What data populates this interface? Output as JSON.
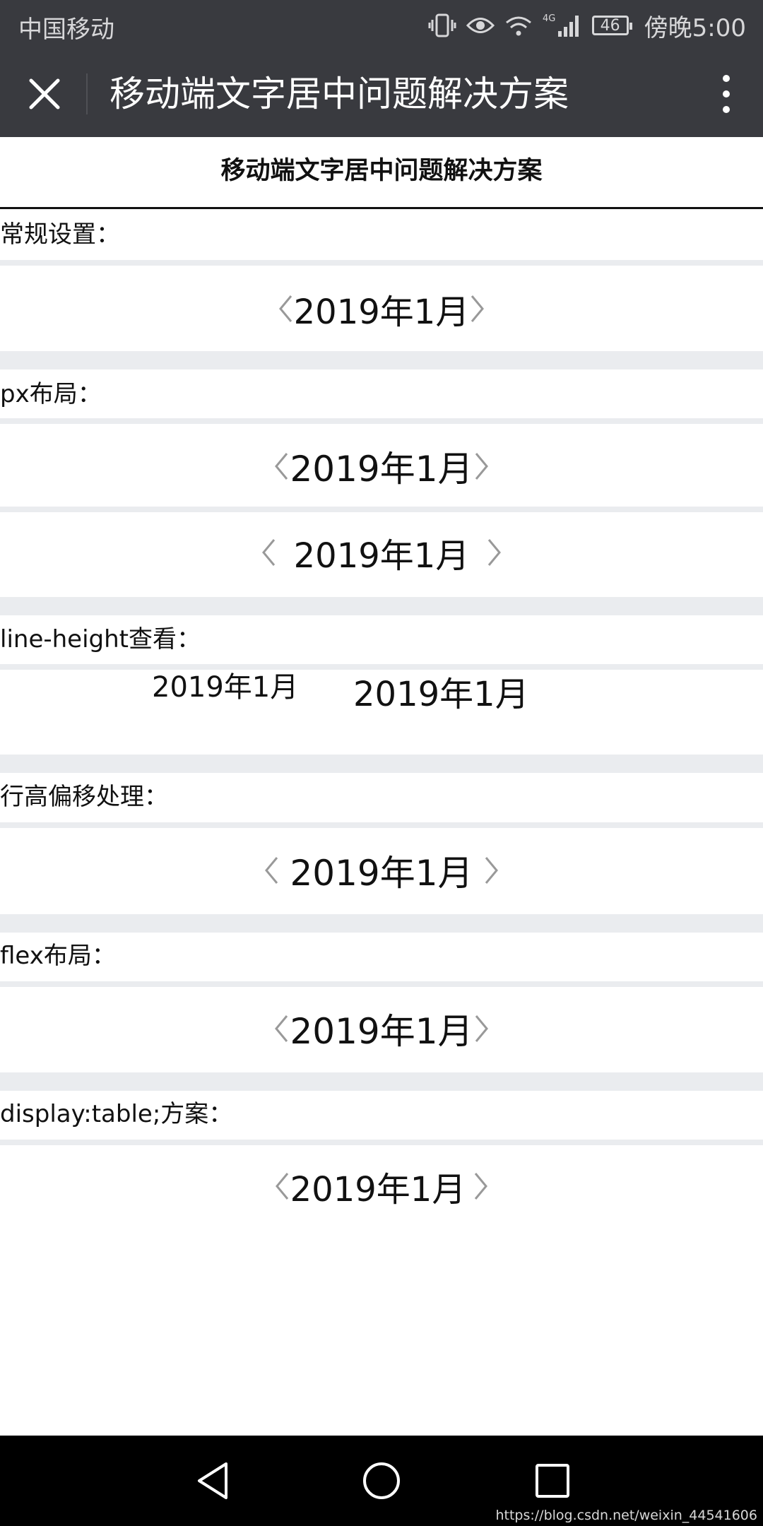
{
  "status_bar": {
    "carrier": "中国移动",
    "battery": "46",
    "network": "4G",
    "time": "傍晚5:00"
  },
  "title_bar": {
    "title": "移动端文字居中问题解决方案",
    "close_icon": "close-icon",
    "more_icon": "more-vertical-icon"
  },
  "page": {
    "heading": "移动端文字居中问题解决方案",
    "date_text": "2019年1月",
    "sections": [
      {
        "label": "常规设置："
      },
      {
        "label": "px布局："
      },
      {
        "label": "line-height查看："
      },
      {
        "label": "行高偏移处理："
      },
      {
        "label": "flex布局："
      },
      {
        "label": "display:table;方案："
      }
    ]
  },
  "nav_bar": {
    "back_icon": "triangle-back-icon",
    "home_icon": "circle-home-icon",
    "recents_icon": "square-recents-icon",
    "watermark": "https://blog.csdn.net/weixin_44541606"
  },
  "colors": {
    "toolbar": "#393a3f",
    "section_gap": "#eaecef",
    "arrow_gray": "#999999"
  }
}
